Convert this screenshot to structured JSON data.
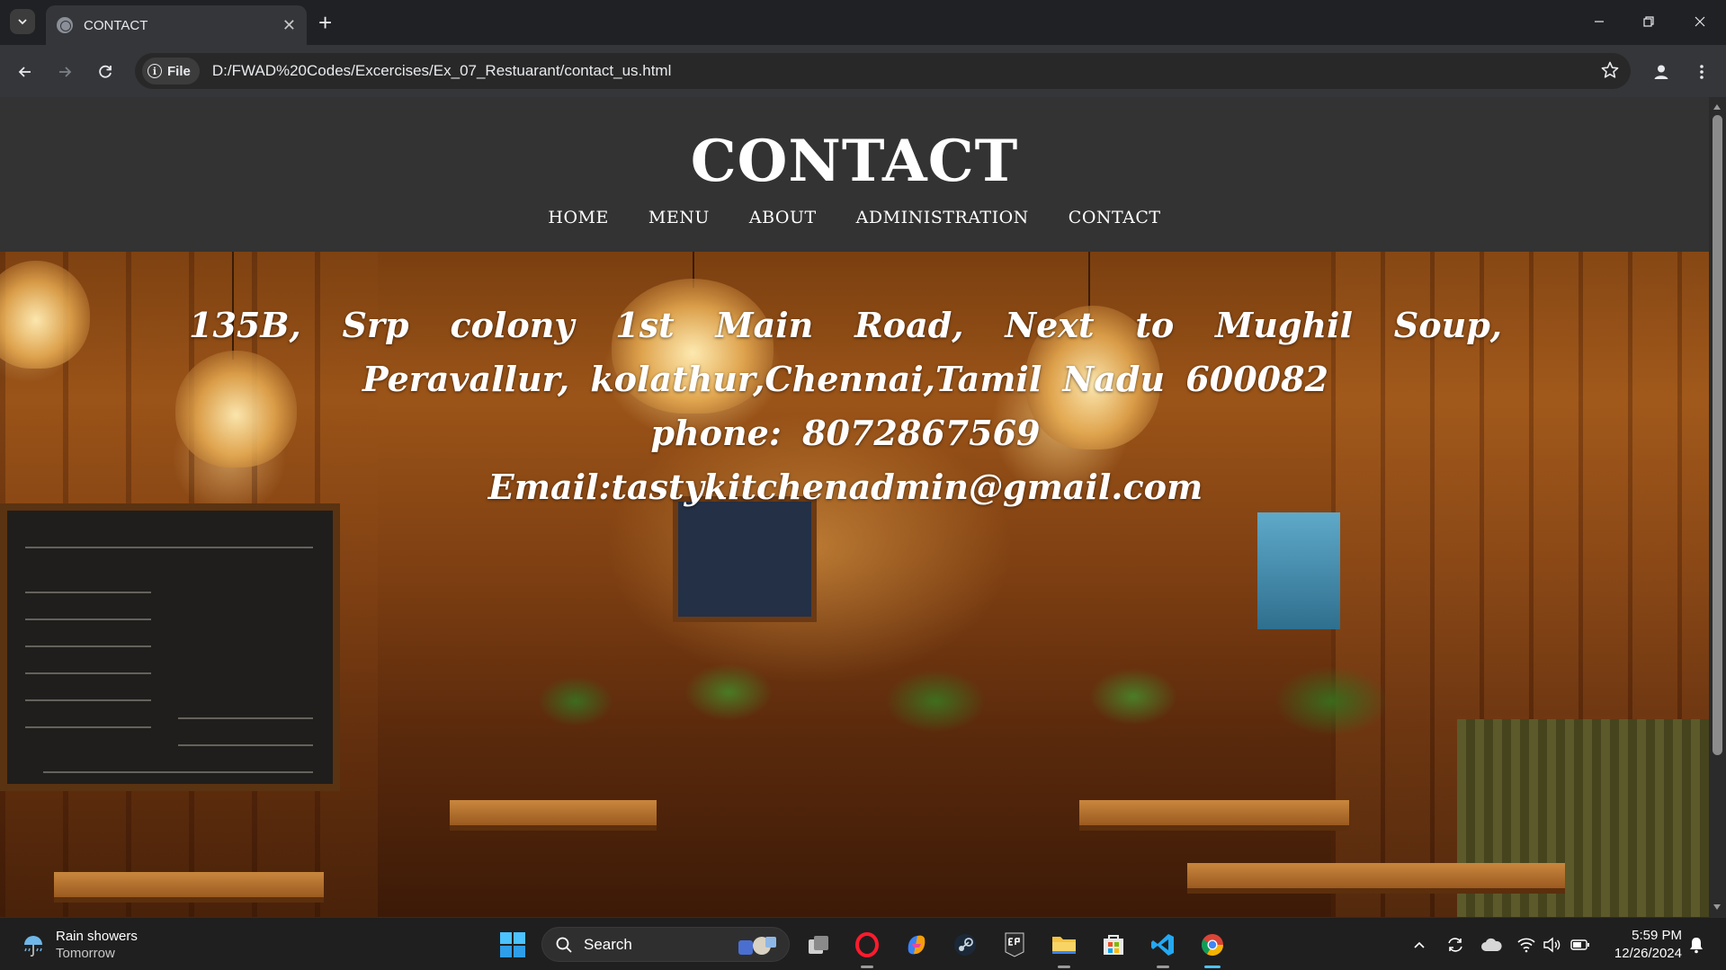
{
  "browser": {
    "tab_title": "CONTACT",
    "site_chip": "File",
    "url": "D:/FWAD%20Codes/Excercises/Ex_07_Restuarant/contact_us.html"
  },
  "site": {
    "title": "CONTACT",
    "nav": [
      "HOME",
      "MENU",
      "ABOUT",
      "ADMINISTRATION",
      "CONTACT"
    ]
  },
  "contact": {
    "address": "135B, Srp colony 1st Main Road, Next to Mughil Soup, Peravallur, kolathur,Chennai,Tamil Nadu 600082",
    "phone": "phone: 8072867569",
    "email": "Email:tastykitchenadmin@gmail.com"
  },
  "taskbar": {
    "weather_title": "Rain showers",
    "weather_sub": "Tomorrow",
    "search_label": "Search",
    "time": "5:59 PM",
    "date": "12/26/2024"
  },
  "colors": {
    "header_bg": "#333333",
    "browser_bg": "#202124",
    "toolbar_bg": "#35363a",
    "accent_blue": "#4cc2ff"
  }
}
